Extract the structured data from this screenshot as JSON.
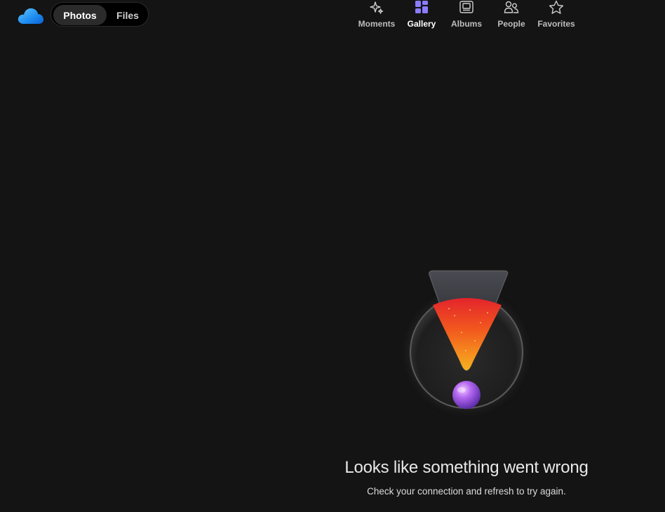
{
  "header": {
    "switcher": {
      "photos_label": "Photos",
      "files_label": "Files"
    },
    "tabs": [
      {
        "label": "Moments",
        "icon": "sparkle-icon"
      },
      {
        "label": "Gallery",
        "icon": "gallery-grid-icon"
      },
      {
        "label": "Albums",
        "icon": "album-icon"
      },
      {
        "label": "People",
        "icon": "people-icon"
      },
      {
        "label": "Favorites",
        "icon": "star-icon"
      }
    ],
    "active_tab": "Gallery",
    "accent_color": "#8a7cff"
  },
  "error": {
    "title": "Looks like something went wrong",
    "message": "Check your connection and refresh to try again."
  }
}
